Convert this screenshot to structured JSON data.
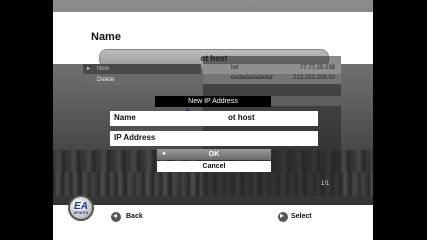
{
  "header": {
    "title": "Name",
    "name_value": "ot host"
  },
  "menu": {
    "items": [
      {
        "label": "New"
      },
      {
        "label": "Delete"
      }
    ]
  },
  "table": {
    "rows": [
      {
        "name": "lwt",
        "address": "77.77.25.238"
      },
      {
        "name": "dadadadadadaf",
        "address": "212.233.209.92"
      }
    ],
    "page_indicator": "1/1"
  },
  "dialog": {
    "title": "New IP Address",
    "name_label": "Name",
    "name_value": "ot host",
    "ip_label": "IP Address",
    "ip_value": "",
    "ok_label": "OK",
    "cancel_label": "Cancel"
  },
  "logo": {
    "text": "EA",
    "subtext": "SPORTS"
  },
  "footer": {
    "back_label": "Back",
    "select_label": "Select"
  },
  "colors": {
    "letterbox": "#000000",
    "panel": "#ffffff",
    "button_selected": "#7d7d7d"
  }
}
